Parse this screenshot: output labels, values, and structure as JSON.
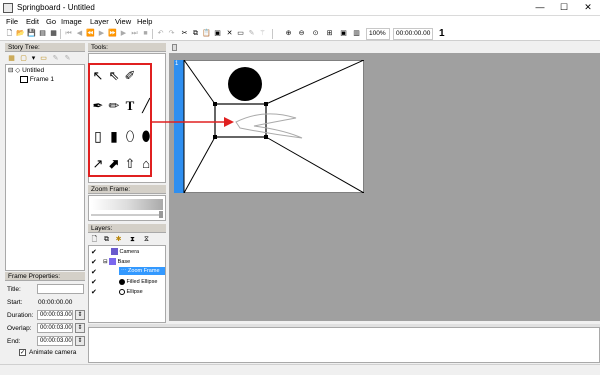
{
  "window": {
    "title": "Springboard - Untitled",
    "min_label": "—",
    "max_label": "☐",
    "close_label": "✕"
  },
  "menu": [
    "File",
    "Edit",
    "Go",
    "Image",
    "Layer",
    "View",
    "Help"
  ],
  "toolbar": {
    "zoom": "100%",
    "time": "00:00:00.00",
    "frame_number": "1"
  },
  "story_tree": {
    "header": "Story Tree:",
    "root": "Untitled",
    "frame": "Frame 1"
  },
  "tools": {
    "header": "Tools:",
    "text_tool_glyph": "T"
  },
  "zoom_frame": {
    "header": "Zoom Frame:"
  },
  "layers": {
    "header": "Layers:",
    "items": [
      "Camera",
      "Base",
      "Zoom Frame",
      "Filled Ellipse",
      "Ellipse"
    ]
  },
  "frame_properties": {
    "header": "Frame Properties:",
    "title_label": "Title:",
    "title_value": "",
    "start_label": "Start:",
    "start_value": "00:00:00.00",
    "duration_label": "Duration:",
    "duration_value": "00:00:03.00",
    "overlap_label": "Overlap:",
    "overlap_value": "00:00:03.00",
    "end_label": "End:",
    "end_value": "00:00:03.00",
    "animate_label": "Animate camera"
  },
  "canvas": {
    "frame_index": "1"
  },
  "colors": {
    "accent_blue": "#2f8ff0",
    "annotation_red": "#e02020",
    "panel_gray": "#a0a0a0"
  }
}
